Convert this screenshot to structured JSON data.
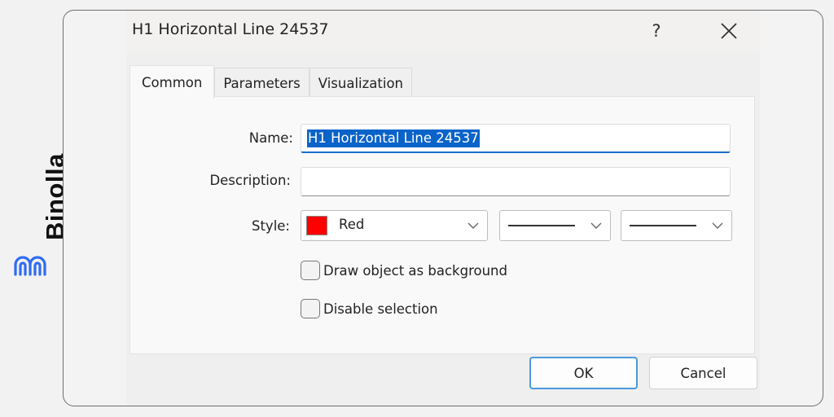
{
  "brand": {
    "name": "Binolla",
    "logo_icon": "binolla-logo-icon",
    "accent_color": "#2f6bf5"
  },
  "dialog": {
    "title": "H1 Horizontal Line 24537",
    "help_label": "?",
    "close_icon": "close-icon"
  },
  "tabs": [
    {
      "label": "Common",
      "active": true
    },
    {
      "label": "Parameters",
      "active": false
    },
    {
      "label": "Visualization",
      "active": false
    }
  ],
  "form": {
    "name_label": "Name:",
    "name_value": "H1 Horizontal Line 24537",
    "description_label": "Description:",
    "description_value": "",
    "style_label": "Style:",
    "color_value": "Red",
    "color_swatch": "#ff0000",
    "line_style_value": "solid",
    "line_width_value": "solid-thin",
    "checkboxes": [
      {
        "label": "Draw object as background",
        "checked": false
      },
      {
        "label": "Disable selection",
        "checked": false
      }
    ]
  },
  "buttons": {
    "ok_label": "OK",
    "cancel_label": "Cancel"
  }
}
